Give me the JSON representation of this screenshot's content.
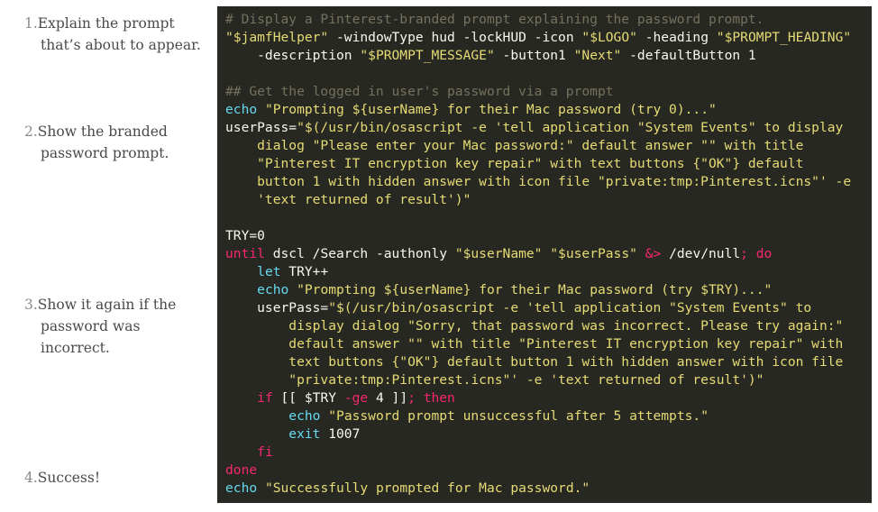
{
  "notes": [
    {
      "num": "1.",
      "line1": "Explain the prompt",
      "line2": "that’s about to appear."
    },
    {
      "num": "2.",
      "line1": "Show the branded",
      "line2": "password prompt."
    },
    {
      "num": "3.",
      "line1": "Show it again if the",
      "line2": "password was",
      "line3": "incorrect."
    },
    {
      "num": "4.",
      "line1": "Success!"
    }
  ],
  "code": {
    "lines": [
      [
        [
          "c",
          "# Display a Pinterest-branded prompt explaining the password prompt."
        ]
      ],
      [
        [
          "s",
          "\"$jamfHelper\""
        ],
        [
          "p",
          " -windowType hud -lockHUD -icon "
        ],
        [
          "s",
          "\"$LOGO\""
        ],
        [
          "p",
          " -heading "
        ],
        [
          "s",
          "\"$PROMPT_HEADING\""
        ]
      ],
      [
        [
          "p",
          "    -description "
        ],
        [
          "s",
          "\"$PROMPT_MESSAGE\""
        ],
        [
          "p",
          " -button1 "
        ],
        [
          "s",
          "\"Next\""
        ],
        [
          "p",
          " -defaultButton 1"
        ]
      ],
      [
        [
          "p",
          ""
        ]
      ],
      [
        [
          "c",
          "## Get the logged in user's password via a prompt"
        ]
      ],
      [
        [
          "b",
          "echo"
        ],
        [
          "p",
          " "
        ],
        [
          "s",
          "\"Prompting ${userName} for their Mac password (try 0)...\""
        ]
      ],
      [
        [
          "p",
          "userPass="
        ],
        [
          "s",
          "\"$(/usr/bin/osascript -e 'tell application \"System Events\" to display"
        ]
      ],
      [
        [
          "s",
          "    dialog \"Please enter your Mac password:\" default answer \"\" with title"
        ]
      ],
      [
        [
          "s",
          "    \"Pinterest IT encryption key repair\" with text buttons {\"OK\"} default"
        ]
      ],
      [
        [
          "s",
          "    button 1 with hidden answer with icon file \"private:tmp:Pinterest.icns\"' -e"
        ]
      ],
      [
        [
          "s",
          "    'text returned of result')\""
        ]
      ],
      [
        [
          "p",
          ""
        ]
      ],
      [
        [
          "p",
          "TRY=0"
        ]
      ],
      [
        [
          "k",
          "until"
        ],
        [
          "p",
          " dscl /Search -authonly "
        ],
        [
          "s",
          "\"$userName\""
        ],
        [
          "p",
          " "
        ],
        [
          "s",
          "\"$userPass\""
        ],
        [
          "p",
          " "
        ],
        [
          "k",
          "&>"
        ],
        [
          "p",
          " /dev/null"
        ],
        [
          "k",
          ";"
        ],
        [
          "p",
          " "
        ],
        [
          "k",
          "do"
        ]
      ],
      [
        [
          "p",
          "    "
        ],
        [
          "b",
          "let"
        ],
        [
          "p",
          " TRY++"
        ]
      ],
      [
        [
          "p",
          "    "
        ],
        [
          "b",
          "echo"
        ],
        [
          "p",
          " "
        ],
        [
          "s",
          "\"Prompting ${userName} for their Mac password (try $TRY)...\""
        ]
      ],
      [
        [
          "p",
          "    userPass="
        ],
        [
          "s",
          "\"$(/usr/bin/osascript -e 'tell application \"System Events\" to"
        ]
      ],
      [
        [
          "s",
          "        display dialog \"Sorry, that password was incorrect. Please try again:\""
        ]
      ],
      [
        [
          "s",
          "        default answer \"\" with title \"Pinterest IT encryption key repair\" with"
        ]
      ],
      [
        [
          "s",
          "        text buttons {\"OK\"} default button 1 with hidden answer with icon file"
        ]
      ],
      [
        [
          "s",
          "        \"private:tmp:Pinterest.icns\"' -e 'text returned of result')\""
        ]
      ],
      [
        [
          "p",
          "    "
        ],
        [
          "k",
          "if"
        ],
        [
          "p",
          " [[ $TRY "
        ],
        [
          "k",
          "-ge"
        ],
        [
          "p",
          " 4 ]]"
        ],
        [
          "k",
          ";"
        ],
        [
          "p",
          " "
        ],
        [
          "k",
          "then"
        ]
      ],
      [
        [
          "p",
          "        "
        ],
        [
          "b",
          "echo"
        ],
        [
          "p",
          " "
        ],
        [
          "s",
          "\"Password prompt unsuccessful after 5 attempts.\""
        ]
      ],
      [
        [
          "p",
          "        "
        ],
        [
          "b",
          "exit"
        ],
        [
          "p",
          " 1007"
        ]
      ],
      [
        [
          "p",
          "    "
        ],
        [
          "k",
          "fi"
        ]
      ],
      [
        [
          "k",
          "done"
        ]
      ],
      [
        [
          "b",
          "echo"
        ],
        [
          "p",
          " "
        ],
        [
          "s",
          "\"Successfully prompted for Mac password.\""
        ]
      ]
    ]
  }
}
